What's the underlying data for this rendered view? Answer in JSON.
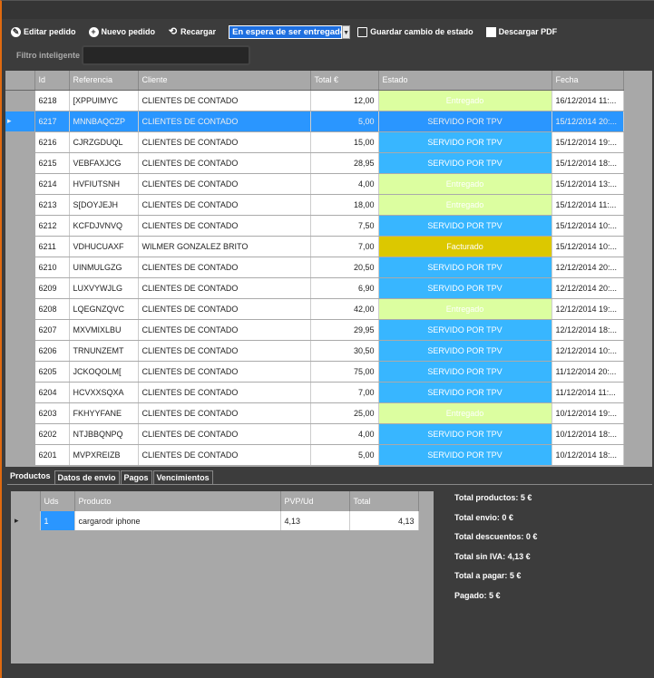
{
  "toolbar": {
    "edit": "Editar pedido",
    "new": "Nuevo pedido",
    "reload": "Recargar",
    "status_select": "En espera de ser entregado",
    "save": "Guardar cambio de estado",
    "pdf": "Descargar PDF"
  },
  "filter": {
    "label": "Filtro inteligente",
    "value": ""
  },
  "orders": {
    "columns": [
      "Id",
      "Referencia",
      "Cliente",
      "Total €",
      "Estado",
      "Fecha"
    ],
    "selected_index": 1,
    "status_colors": {
      "Entregado": "#dcfea0",
      "SERVIDO POR TPV": "#38b6ff",
      "Facturado": "#dcc800"
    },
    "rows": [
      {
        "id": "6218",
        "ref": "[XPPUIMYC",
        "client": "CLIENTES DE CONTADO",
        "total": "12,00",
        "status": "Entregado",
        "date": "16/12/2014 11:..."
      },
      {
        "id": "6217",
        "ref": "MNNBAQCZP",
        "client": "CLIENTES DE CONTADO",
        "total": "5,00",
        "status": "SERVIDO POR TPV",
        "date": "15/12/2014 20:..."
      },
      {
        "id": "6216",
        "ref": "CJRZGDUQL",
        "client": "CLIENTES DE CONTADO",
        "total": "15,00",
        "status": "SERVIDO POR TPV",
        "date": "15/12/2014 19:..."
      },
      {
        "id": "6215",
        "ref": "VEBFAXJCG",
        "client": "CLIENTES DE CONTADO",
        "total": "28,95",
        "status": "SERVIDO POR TPV",
        "date": "15/12/2014 18:..."
      },
      {
        "id": "6214",
        "ref": "HVFIUTSNH",
        "client": "CLIENTES DE CONTADO",
        "total": "4,00",
        "status": "Entregado",
        "date": "15/12/2014 13:..."
      },
      {
        "id": "6213",
        "ref": "S[DOYJEJH",
        "client": "CLIENTES DE CONTADO",
        "total": "18,00",
        "status": "Entregado",
        "date": "15/12/2014 11:..."
      },
      {
        "id": "6212",
        "ref": "KCFDJVNVQ",
        "client": "CLIENTES DE CONTADO",
        "total": "7,50",
        "status": "SERVIDO POR TPV",
        "date": "15/12/2014 10:..."
      },
      {
        "id": "6211",
        "ref": "VDHUCUAXF",
        "client": "WILMER GONZALEZ BRITO",
        "total": "7,00",
        "status": "Facturado",
        "date": "15/12/2014 10:..."
      },
      {
        "id": "6210",
        "ref": "UINMULGZG",
        "client": "CLIENTES DE CONTADO",
        "total": "20,50",
        "status": "SERVIDO POR TPV",
        "date": "12/12/2014 20:..."
      },
      {
        "id": "6209",
        "ref": "LUXVYWJLG",
        "client": "CLIENTES DE CONTADO",
        "total": "6,90",
        "status": "SERVIDO POR TPV",
        "date": "12/12/2014 20:..."
      },
      {
        "id": "6208",
        "ref": "LQEGNZQVC",
        "client": "CLIENTES DE CONTADO",
        "total": "42,00",
        "status": "Entregado",
        "date": "12/12/2014 19:..."
      },
      {
        "id": "6207",
        "ref": "MXVMIXLBU",
        "client": "CLIENTES DE CONTADO",
        "total": "29,95",
        "status": "SERVIDO POR TPV",
        "date": "12/12/2014 18:..."
      },
      {
        "id": "6206",
        "ref": "TRNUNZEMT",
        "client": "CLIENTES DE CONTADO",
        "total": "30,50",
        "status": "SERVIDO POR TPV",
        "date": "12/12/2014 10:..."
      },
      {
        "id": "6205",
        "ref": "JCKOQOLM[",
        "client": "CLIENTES DE CONTADO",
        "total": "75,00",
        "status": "SERVIDO POR TPV",
        "date": "11/12/2014 20:..."
      },
      {
        "id": "6204",
        "ref": "HCVXXSQXA",
        "client": "CLIENTES DE CONTADO",
        "total": "7,00",
        "status": "SERVIDO POR TPV",
        "date": "11/12/2014 11:..."
      },
      {
        "id": "6203",
        "ref": "FKHYYFANE",
        "client": "CLIENTES DE CONTADO",
        "total": "25,00",
        "status": "Entregado",
        "date": "10/12/2014 19:..."
      },
      {
        "id": "6202",
        "ref": "NTJBBQNPQ",
        "client": "CLIENTES DE CONTADO",
        "total": "4,00",
        "status": "SERVIDO POR TPV",
        "date": "10/12/2014 18:..."
      },
      {
        "id": "6201",
        "ref": "MVPXREIZB",
        "client": "CLIENTES DE CONTADO",
        "total": "5,00",
        "status": "SERVIDO POR TPV",
        "date": "10/12/2014 18:..."
      }
    ]
  },
  "tabs": [
    "Productos",
    "Datos de envio",
    "Pagos",
    "Vencimientos"
  ],
  "products": {
    "columns": [
      "Uds",
      "Producto",
      "PVP/Ud",
      "Total"
    ],
    "rows": [
      {
        "uds": "1",
        "name": "cargarodr iphone",
        "pvp": "4,13",
        "total": "4,13"
      }
    ]
  },
  "summary": [
    "Total productos: 5 €",
    "Total envio: 0 €",
    "Total descuentos: 0 €",
    "Total sin IVA: 4,13 €",
    "Total a pagar: 5 €",
    "Pagado: 5 €"
  ]
}
